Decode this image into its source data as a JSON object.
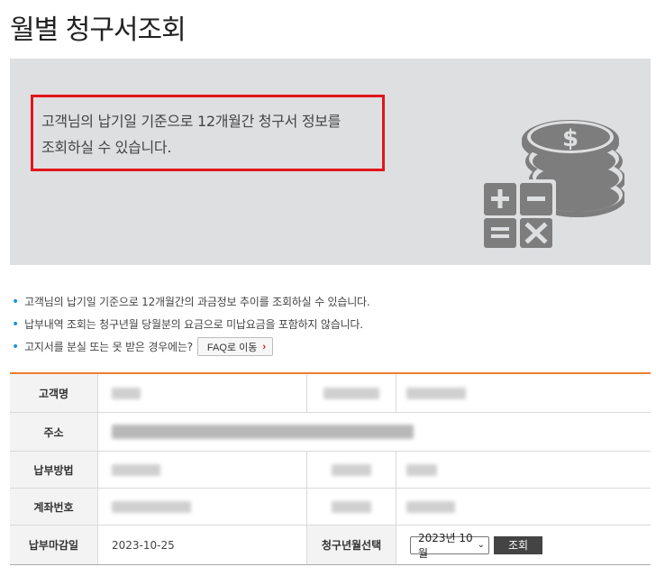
{
  "page": {
    "title": "월별 청구서조회"
  },
  "banner": {
    "notice_line1": "고객님의 납기일 기준으로 12개월간 청구서 정보를",
    "notice_line2": "조회하실 수 있습니다.",
    "illustration_icon": "coins-calculator-icon",
    "coin_symbol": "$"
  },
  "info": {
    "items": [
      {
        "text": "고객님의 납기일 기준으로 12개월간의 과금정보 추이를 조회하실 수 있습니다."
      },
      {
        "text": "납부내역 조회는 청구년월 당월분의 요금으로 미납요금을 포함하지 않습니다."
      },
      {
        "text": "고지서를 분실 또는 못 받은 경우에는?"
      }
    ],
    "faq_button_label": "FAQ로 이동",
    "faq_arrow": "›"
  },
  "table": {
    "customer_name_label": "고객명",
    "address_label": "주소",
    "payment_method_label": "납부방법",
    "account_number_label": "계좌번호",
    "due_date_label": "납부마감일",
    "due_date_value": "2023-10-25",
    "billing_month_label": "청구년월선택",
    "billing_month_selected": "2023년 10월",
    "search_button_label": "조회"
  },
  "colors": {
    "accent_border": "#f07c33",
    "notice_border": "#e0161c",
    "bullet": "#1e94d2",
    "banner_bg": "#dedfe1"
  }
}
